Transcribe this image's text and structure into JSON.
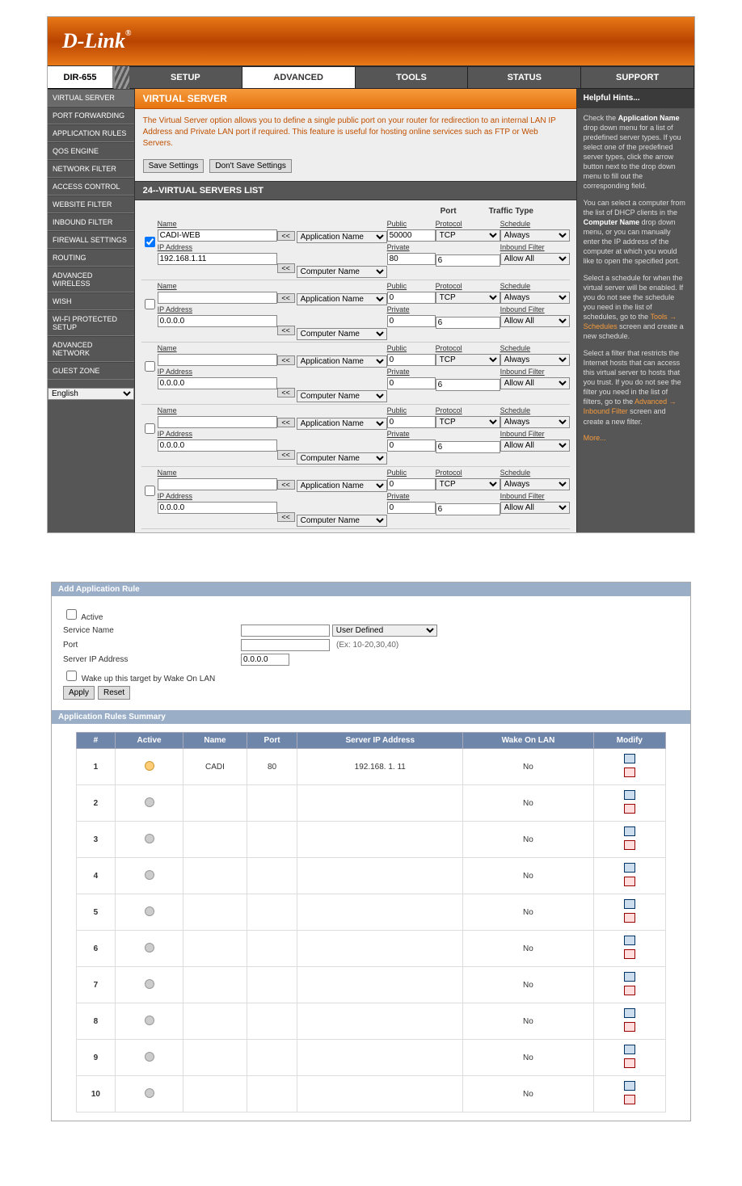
{
  "brand": "D-Link",
  "model": "DIR-655",
  "tabs": [
    "SETUP",
    "ADVANCED",
    "TOOLS",
    "STATUS",
    "SUPPORT"
  ],
  "tab_active": 1,
  "sidebar": [
    "VIRTUAL SERVER",
    "PORT FORWARDING",
    "APPLICATION RULES",
    "QOS ENGINE",
    "NETWORK FILTER",
    "ACCESS CONTROL",
    "WEBSITE FILTER",
    "INBOUND FILTER",
    "FIREWALL SETTINGS",
    "ROUTING",
    "ADVANCED WIRELESS",
    "WISH",
    "WI-FI PROTECTED SETUP",
    "ADVANCED NETWORK",
    "GUEST ZONE"
  ],
  "language": "English",
  "page_title": "VIRTUAL SERVER",
  "page_desc": "The Virtual Server option allows you to define a single public port on your router for redirection to an internal LAN IP Address and Private LAN port if required. This feature is useful for hosting online services such as FTP or Web Servers.",
  "btn_save": "Save Settings",
  "btn_dont": "Don't Save Settings",
  "section": "24--VIRTUAL SERVERS LIST",
  "ghdr": {
    "port": "Port",
    "traffic": "Traffic Type"
  },
  "labels": {
    "name": "Name",
    "ip": "IP Address",
    "public": "Public",
    "private": "Private",
    "protocol": "Protocol",
    "schedule": "Schedule",
    "inbound": "Inbound Filter"
  },
  "arrow": "<<",
  "appname": "Application Name",
  "compname": "Computer Name",
  "schedule_opt": "Always",
  "inbound_opt": "Allow All",
  "proto_opt": "TCP",
  "rows": [
    {
      "checked": true,
      "name": "CADI-WEB",
      "ip": "192.168.1.11",
      "public": "50000",
      "private": "80",
      "proto2": "6"
    },
    {
      "checked": false,
      "name": "",
      "ip": "0.0.0.0",
      "public": "0",
      "private": "0",
      "proto2": "6"
    },
    {
      "checked": false,
      "name": "",
      "ip": "0.0.0.0",
      "public": "0",
      "private": "0",
      "proto2": "6"
    },
    {
      "checked": false,
      "name": "",
      "ip": "0.0.0.0",
      "public": "0",
      "private": "0",
      "proto2": "6"
    },
    {
      "checked": false,
      "name": "",
      "ip": "0.0.0.0",
      "public": "0",
      "private": "0",
      "proto2": "6"
    }
  ],
  "hints_title": "Helpful Hints...",
  "hints": [
    "Check the <b>Application Name</b> drop down menu for a list of predefined server types. If you select one of the predefined server types, click the arrow button next to the drop down menu to fill out the corresponding field.",
    "You can select a computer from the list of DHCP clients in the <b>Computer Name</b> drop down menu, or you can manually enter the IP address of the computer at which you would like to open the specified port.",
    "Select a schedule for when the virtual server will be enabled. If you do not see the schedule you need in the list of schedules, go to the <a>Tools → Schedules</a> screen and create a new schedule.",
    "Select a filter that restricts the Internet hosts that can access this virtual server to hosts that you trust. If you do not see the filter you need in the list of filters, go to the <a>Advanced → Inbound Filter</a> screen and create a new filter.",
    "<a>More...</a>"
  ],
  "panel2": {
    "bar1": "Add Application Rule",
    "active": "Active",
    "service": "Service Name",
    "port": "Port",
    "serverip": "Server IP Address",
    "serverip_val": "0.0.0.0",
    "userdef": "User Defined",
    "porthint": "(Ex: 10-20,30,40)",
    "wake": "Wake up this target by Wake On LAN",
    "apply": "Apply",
    "reset": "Reset",
    "bar2": "Application Rules Summary",
    "cols": [
      "#",
      "Active",
      "Name",
      "Port",
      "Server IP Address",
      "Wake On LAN",
      "Modify"
    ],
    "rows": [
      {
        "n": "1",
        "active": true,
        "name": "CADI",
        "port": "80",
        "ip": "192.168. 1. 11",
        "wol": "No"
      },
      {
        "n": "2",
        "active": false,
        "name": "",
        "port": "",
        "ip": "",
        "wol": "No"
      },
      {
        "n": "3",
        "active": false,
        "name": "",
        "port": "",
        "ip": "",
        "wol": "No"
      },
      {
        "n": "4",
        "active": false,
        "name": "",
        "port": "",
        "ip": "",
        "wol": "No"
      },
      {
        "n": "5",
        "active": false,
        "name": "",
        "port": "",
        "ip": "",
        "wol": "No"
      },
      {
        "n": "6",
        "active": false,
        "name": "",
        "port": "",
        "ip": "",
        "wol": "No"
      },
      {
        "n": "7",
        "active": false,
        "name": "",
        "port": "",
        "ip": "",
        "wol": "No"
      },
      {
        "n": "8",
        "active": false,
        "name": "",
        "port": "",
        "ip": "",
        "wol": "No"
      },
      {
        "n": "9",
        "active": false,
        "name": "",
        "port": "",
        "ip": "",
        "wol": "No"
      },
      {
        "n": "10",
        "active": false,
        "name": "",
        "port": "",
        "ip": "",
        "wol": "No"
      }
    ]
  }
}
